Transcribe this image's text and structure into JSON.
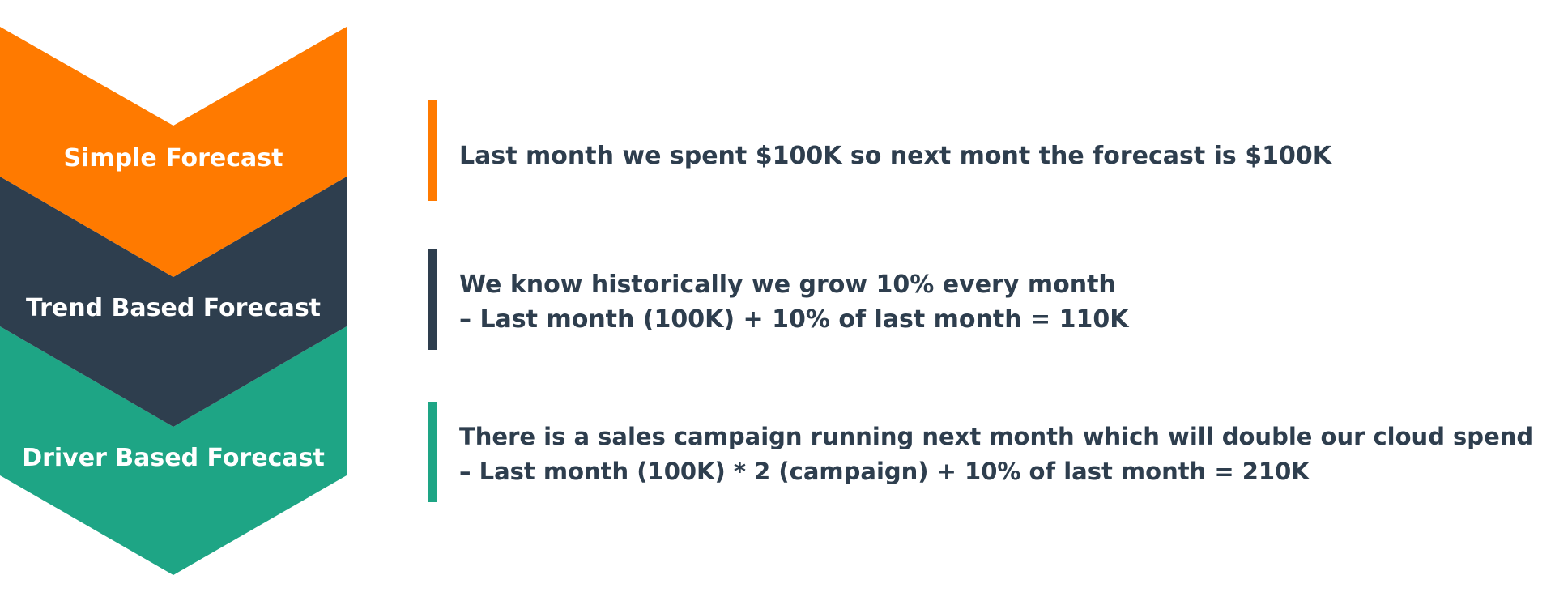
{
  "colors": {
    "orange": "#ff7a00",
    "navy": "#2e3e4e",
    "green": "#1ea585",
    "text": "#2e3e4e",
    "label_text": "#ffffff"
  },
  "stages": [
    {
      "label": "Simple Forecast",
      "color": "#ff7a00",
      "description": [
        "Last month we spent $100K so next mont the forecast is $100K"
      ]
    },
    {
      "label": "Trend Based Forecast",
      "color": "#2e3e4e",
      "description": [
        "We know historically we grow 10% every month",
        "–  Last month (100K) + 10% of last month = 110K"
      ]
    },
    {
      "label": "Driver Based Forecast",
      "color": "#1ea585",
      "description": [
        "There is a sales campaign running next month which will double our cloud spend",
        "–  Last month (100K) * 2 (campaign) + 10% of last month = 210K"
      ]
    }
  ]
}
